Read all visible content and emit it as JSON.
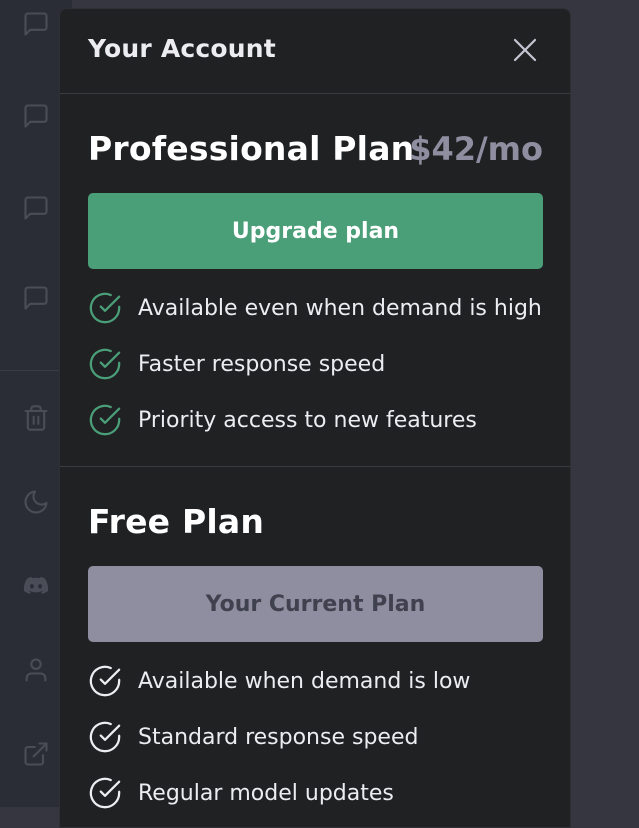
{
  "modal": {
    "title": "Your Account",
    "close_icon": "close-icon"
  },
  "professional_plan": {
    "name": "Professional Plan",
    "price": "$42/mo",
    "button_label": "Upgrade plan",
    "button_color": "#4a9e78",
    "check_color": "#4a9e78",
    "features": [
      "Available even when demand is high",
      "Faster response speed",
      "Priority access to new features"
    ]
  },
  "free_plan": {
    "name": "Free Plan",
    "button_label": "Your Current Plan",
    "button_color": "#8e8ea0",
    "check_color": "#ececf1",
    "features": [
      "Available when demand is low",
      "Standard response speed",
      "Regular model updates"
    ]
  },
  "sidebar": {
    "icons": [
      "chat-icon",
      "chat-icon",
      "chat-icon",
      "chat-icon",
      "trash-icon",
      "moon-icon",
      "discord-icon",
      "user-icon",
      "external-link-icon"
    ]
  }
}
